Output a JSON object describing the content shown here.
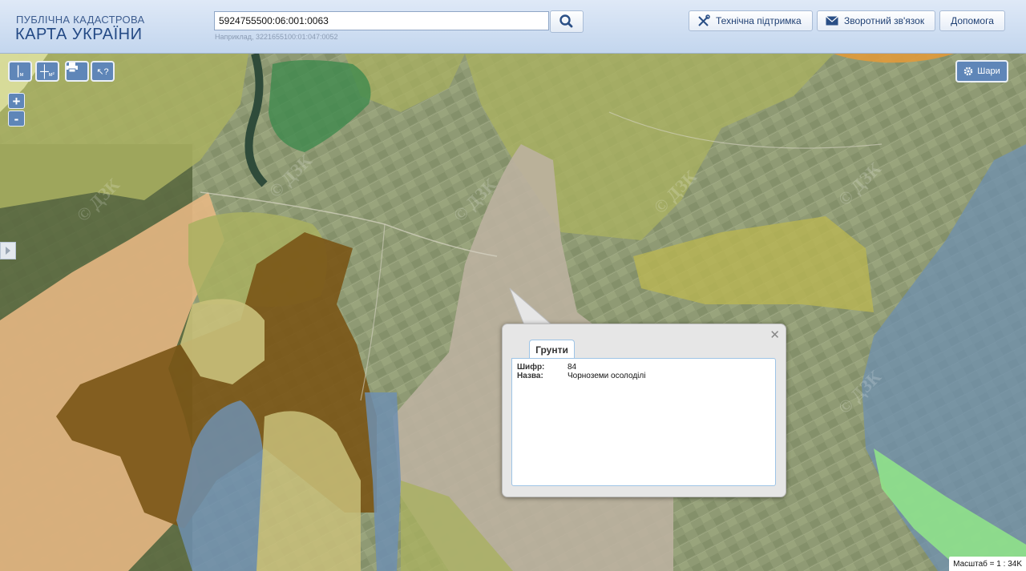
{
  "header": {
    "logo_line1": "ПУБЛІЧНА КАДАСТРОВА",
    "logo_line2": "КАРТА УКРАЇНИ",
    "search_value": "5924755500:06:001:0063",
    "search_hint": "Наприклад, 3221655100:01:047:0052",
    "buttons": {
      "support": "Технічна підтримка",
      "feedback": "Зворотний зв'язок",
      "help": "Допомога"
    }
  },
  "map": {
    "layers_button": "Шари",
    "zoom_in": "+",
    "zoom_out": "-",
    "tool_measure_line_unit": "м",
    "tool_measure_area_unit": "м²",
    "scale_text": "Масштаб = 1 : 34K",
    "watermark": "© ДЗК"
  },
  "popup": {
    "tab_label": "Грунти",
    "rows": [
      {
        "key": "Шифр:",
        "value": "84"
      },
      {
        "key": "Назва:",
        "value": "Чорноземи осолоділі"
      }
    ]
  },
  "colors": {
    "header_bg": "#c3d6ee",
    "button_blue": "#5f86b8",
    "soil_olive": "#a7ae5a",
    "soil_brown": "#7a5516",
    "soil_peach": "#e8b884",
    "soil_beige": "#bdb2a0",
    "soil_blue": "#6e8fb0",
    "soil_green": "#3e8a4e",
    "soil_lightgreen": "#90e28a"
  }
}
